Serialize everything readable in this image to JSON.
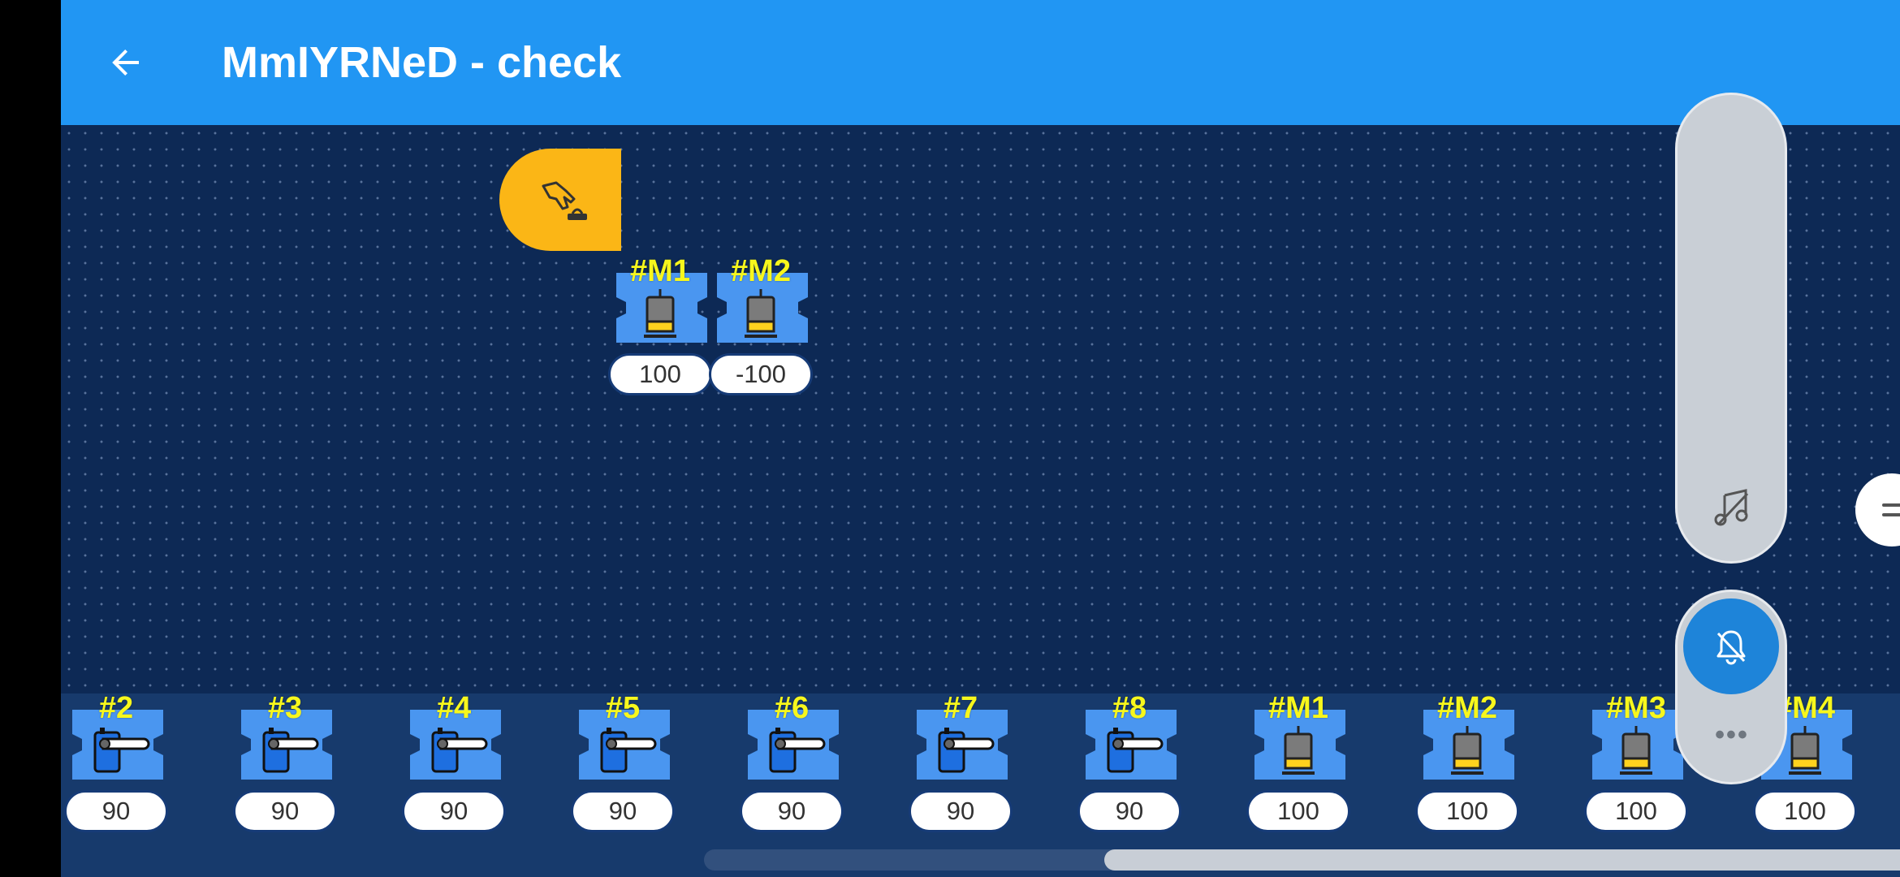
{
  "header": {
    "title": "MmIYRNeD - check",
    "back_icon": "arrow-left-icon"
  },
  "colors": {
    "appbar": "#2196f3",
    "canvas": "#0d2955",
    "block": "#4a96f0",
    "hat": "#fbb616",
    "label": "#f7f71c"
  },
  "workspace": {
    "start_block_icon": "hand-press-button-icon",
    "blocks": [
      {
        "label": "#M1",
        "value": "100",
        "icon": "motor-icon"
      },
      {
        "label": "#M2",
        "value": "-100",
        "icon": "motor-icon"
      }
    ]
  },
  "palette": {
    "blocks": [
      {
        "label": "#2",
        "value": "90",
        "icon": "servo-icon"
      },
      {
        "label": "#3",
        "value": "90",
        "icon": "servo-icon"
      },
      {
        "label": "#4",
        "value": "90",
        "icon": "servo-icon"
      },
      {
        "label": "#5",
        "value": "90",
        "icon": "servo-icon"
      },
      {
        "label": "#6",
        "value": "90",
        "icon": "servo-icon"
      },
      {
        "label": "#7",
        "value": "90",
        "icon": "servo-icon"
      },
      {
        "label": "#8",
        "value": "90",
        "icon": "servo-icon"
      },
      {
        "label": "#M1",
        "value": "100",
        "icon": "motor-icon"
      },
      {
        "label": "#M2",
        "value": "100",
        "icon": "motor-icon"
      },
      {
        "label": "#M3",
        "value": "100",
        "icon": "motor-icon"
      },
      {
        "label": "#M4",
        "value": "100",
        "icon": "motor-icon"
      }
    ]
  },
  "controls": {
    "music_icon": "music-off-icon",
    "bell_icon": "bell-off-icon",
    "more_label": "•••",
    "menu_icon": "equals-icon"
  }
}
